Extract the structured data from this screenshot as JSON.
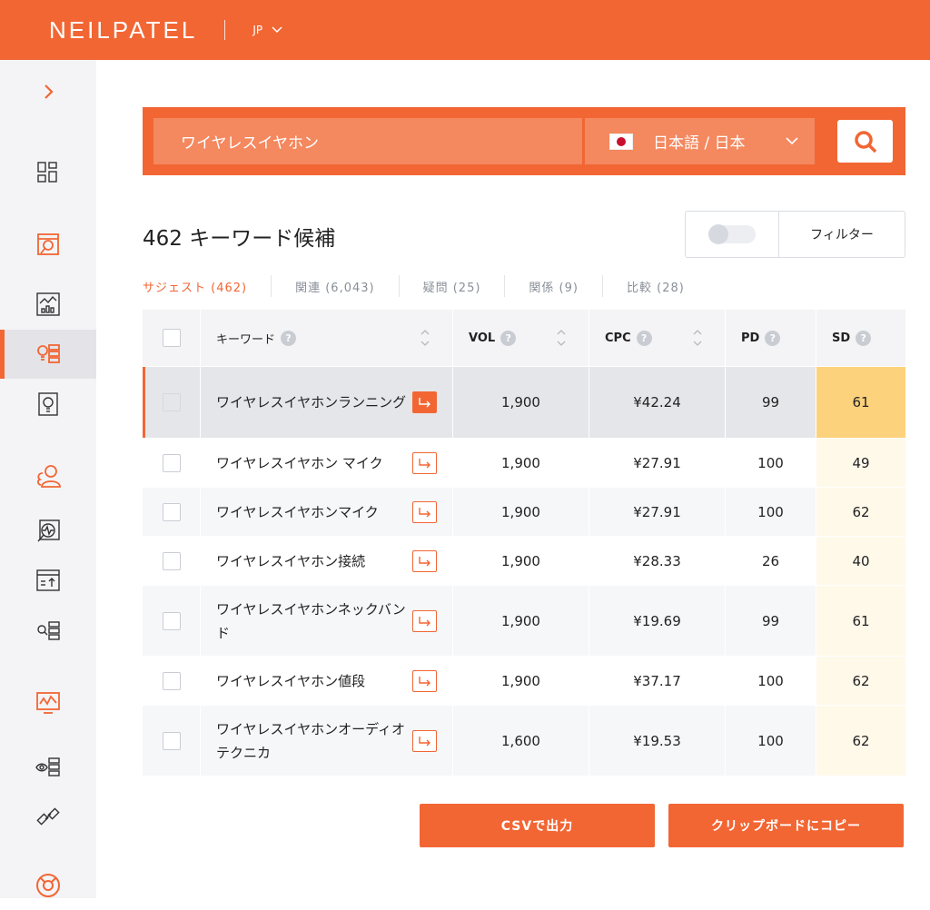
{
  "header": {
    "logo": "NEILPATEL",
    "language": "JP"
  },
  "search": {
    "query": "ワイヤレスイヤホン",
    "language_label": "日本語 / 日本"
  },
  "results": {
    "title": "462 キーワード候補",
    "filter_label": "フィルター"
  },
  "tabs": [
    {
      "label": "サジェスト (462)"
    },
    {
      "label": "関連 (6,043)"
    },
    {
      "label": "疑問 (25)"
    },
    {
      "label": "関係 (9)"
    },
    {
      "label": "比較 (28)"
    }
  ],
  "table": {
    "headers": {
      "keyword": "キーワード",
      "vol": "VOL",
      "cpc": "CPC",
      "pd": "PD",
      "sd": "SD"
    },
    "rows": [
      {
        "keyword": "ワイヤレスイヤホンランニング",
        "vol": "1,900",
        "cpc": "¥42.24",
        "pd": "99",
        "sd": "61"
      },
      {
        "keyword": "ワイヤレスイヤホン マイク",
        "vol": "1,900",
        "cpc": "¥27.91",
        "pd": "100",
        "sd": "49"
      },
      {
        "keyword": "ワイヤレスイヤホンマイク",
        "vol": "1,900",
        "cpc": "¥27.91",
        "pd": "100",
        "sd": "62"
      },
      {
        "keyword": "ワイヤレスイヤホン接続",
        "vol": "1,900",
        "cpc": "¥28.33",
        "pd": "26",
        "sd": "40"
      },
      {
        "keyword": "ワイヤレスイヤホンネックバンド",
        "vol": "1,900",
        "cpc": "¥19.69",
        "pd": "99",
        "sd": "61"
      },
      {
        "keyword": "ワイヤレスイヤホン値段",
        "vol": "1,900",
        "cpc": "¥37.17",
        "pd": "100",
        "sd": "62"
      },
      {
        "keyword": "ワイヤレスイヤホンオーディオテクニカ",
        "vol": "1,600",
        "cpc": "¥19.53",
        "pd": "100",
        "sd": "62"
      }
    ]
  },
  "buttons": {
    "csv": "CSVで出力",
    "clipboard": "クリップボードにコピー"
  },
  "colors": {
    "accent": "#f26634",
    "sd_highlight": "#fdd27c"
  }
}
